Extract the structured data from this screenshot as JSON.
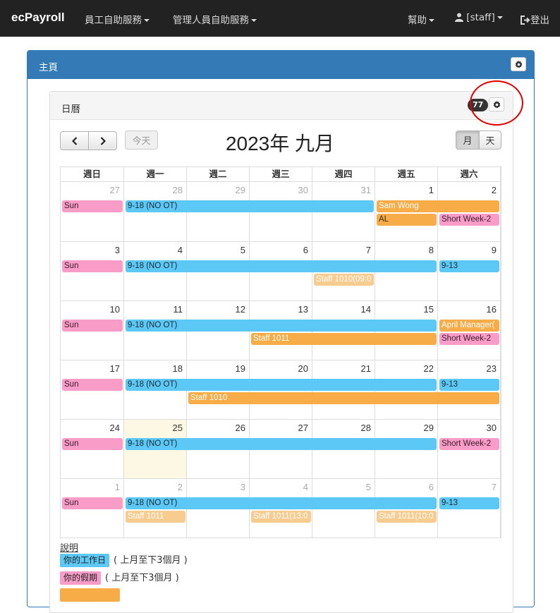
{
  "nav": {
    "brand": "ecPayroll",
    "employee_menu": "員工自助服務",
    "manager_menu": "管理人員自助服務",
    "help": "幫助",
    "user": "[staff]",
    "logout": "登出"
  },
  "panel": {
    "title": "主頁"
  },
  "calendar": {
    "title": "日曆",
    "badge": "77",
    "today_button": "今天",
    "month_title": "2023年 九月",
    "view_month": "月",
    "view_day": "天",
    "weekdays": [
      "週日",
      "週一",
      "週二",
      "週三",
      "週四",
      "週五",
      "週六"
    ],
    "weeks": [
      [
        "27",
        "28",
        "29",
        "30",
        "31",
        "1",
        "2"
      ],
      [
        "3",
        "4",
        "5",
        "6",
        "7",
        "8",
        "9"
      ],
      [
        "10",
        "11",
        "12",
        "13",
        "14",
        "15",
        "16"
      ],
      [
        "17",
        "18",
        "19",
        "20",
        "21",
        "22",
        "23"
      ],
      [
        "24",
        "25",
        "26",
        "27",
        "28",
        "29",
        "30"
      ],
      [
        "1",
        "2",
        "3",
        "4",
        "5",
        "6",
        "7"
      ]
    ],
    "events": {
      "sun": "Sun",
      "shift": "9-18 (NO OT)",
      "sam": "Sam Wong",
      "al": "AL",
      "short_week": "Short Week-2",
      "half_day": "9-13",
      "staff1010_partial": "Staff 1010(09:0",
      "april": "April Manager(",
      "staff1011": "Staff 1011",
      "staff1010": "Staff 1010",
      "staff1011_13": "Staff 1011(13:0",
      "staff1011_10": "Staff 1011(10:0"
    }
  },
  "legend": {
    "title": "說明",
    "workday_label": "你的工作日",
    "workday_range": "( 上月至下3個月 )",
    "holiday_label": "你的假期",
    "holiday_range": "( 上月至下3個月 )"
  },
  "colors": {
    "navbar": "#222222",
    "panel_primary": "#337ab7",
    "event_blue": "#5bc8f5",
    "event_pink": "#f99dc8",
    "event_orange": "#f7ac48",
    "today_highlight": "#fcf8e3",
    "annotation_circle": "#e00000"
  }
}
